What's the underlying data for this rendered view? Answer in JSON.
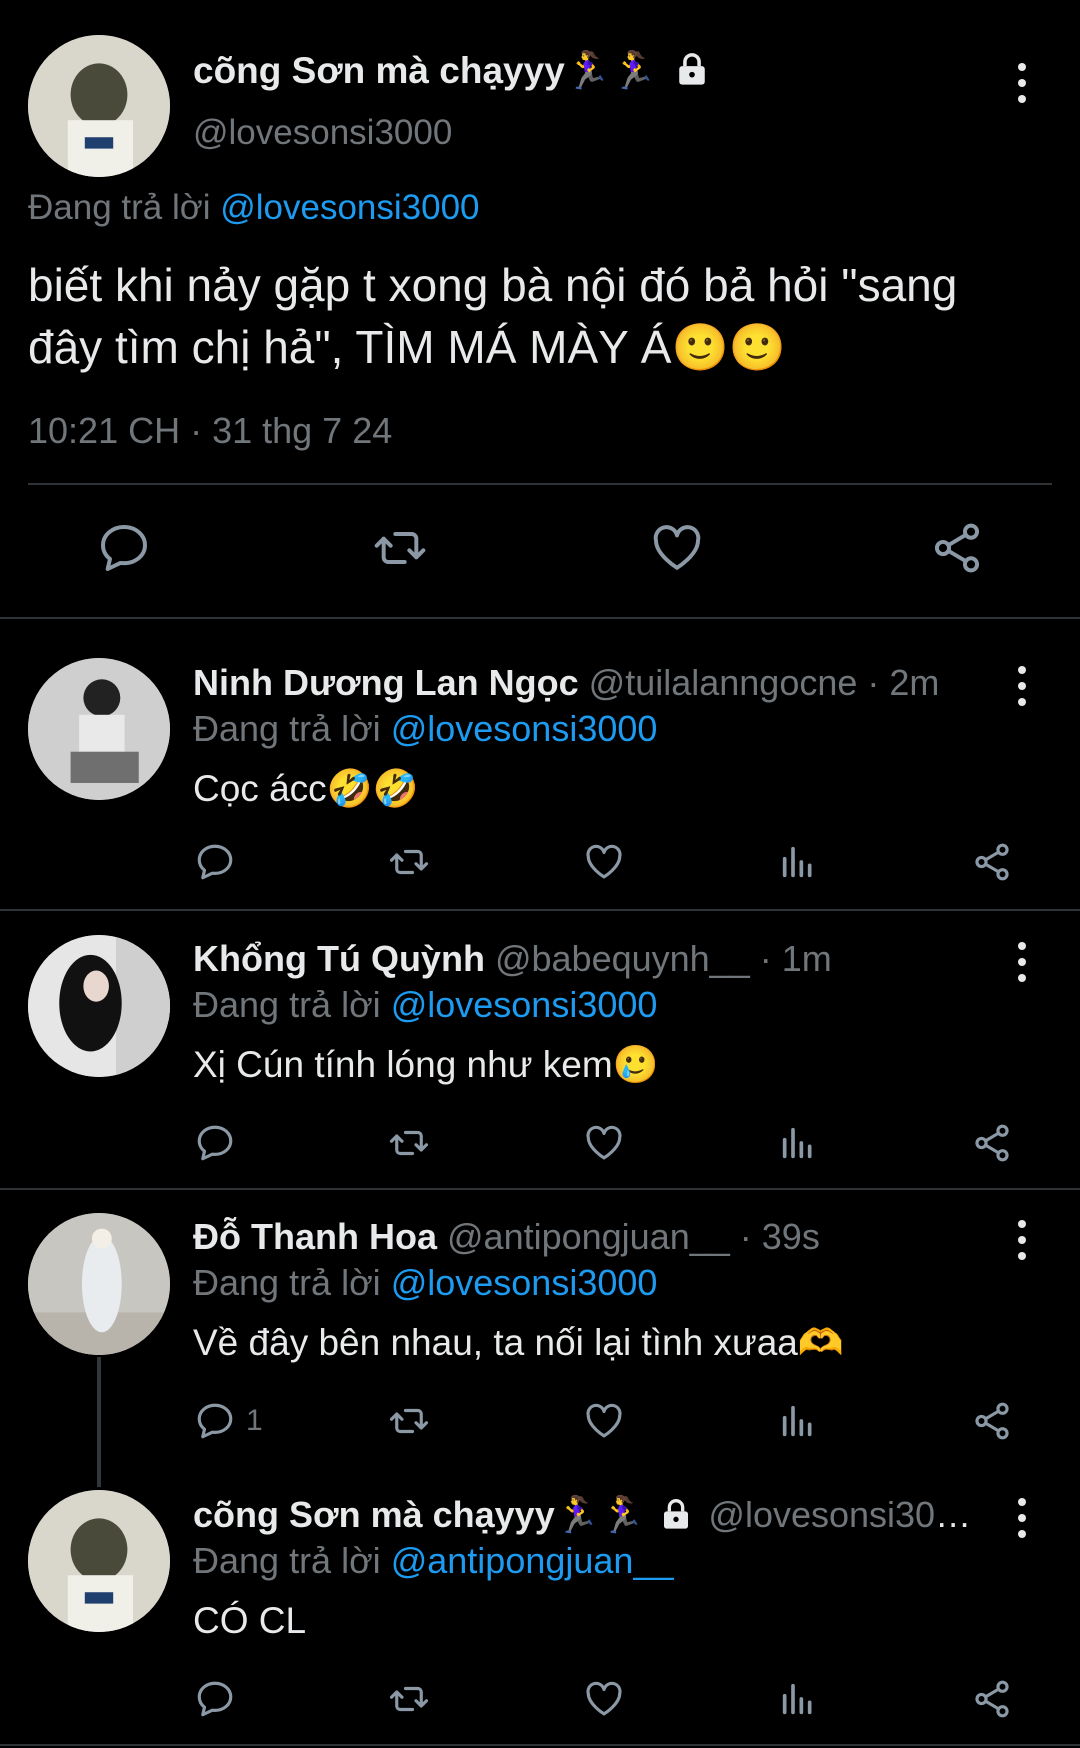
{
  "main": {
    "display_name": "cõng Sơn mà chạyyy🏃‍♀️🏃‍♀️",
    "handle": "@lovesonsi3000",
    "replying_prefix": "Đang trả lời",
    "replying_to": "@lovesonsi3000",
    "text": "biết khi nảy gặp t xong bà nội đó bả hỏi \"sang đây tìm chị hả\", TÌM MÁ MÀY Á🙂🙂",
    "timestamp": "10:21 CH · 31 thg 7 24"
  },
  "replies": [
    {
      "display_name": "Ninh Dương Lan Ngọc",
      "handle": "@tuilalanngocne",
      "time": "· 2m",
      "replying_prefix": "Đang trả lời",
      "replying_to": "@lovesonsi3000",
      "text": "Cọc ácc🤣🤣",
      "reply_count": ""
    },
    {
      "display_name": "Khổng Tú Quỳnh",
      "handle": "@babequynh__",
      "time": "· 1m",
      "replying_prefix": "Đang trả lời",
      "replying_to": "@lovesonsi3000",
      "text": "Xị Cún tính lóng như kem🥲",
      "reply_count": ""
    },
    {
      "display_name": "Đỗ Thanh Hoa",
      "handle": "@antipongjuan__",
      "time": "· 39s",
      "replying_prefix": "Đang trả lời",
      "replying_to": "@lovesonsi3000",
      "text": "Về đây bên nhau, ta nối lại tình xưaa🫶",
      "reply_count": "1"
    },
    {
      "display_name": "cõng Sơn mà chạyyy🏃‍♀️🏃‍♀️",
      "handle": "@lovesonsi300...",
      "time": "",
      "replying_prefix": "Đang trả lời",
      "replying_to": "@antipongjuan__",
      "text": "CÓ CL",
      "reply_count": ""
    }
  ],
  "icons": {
    "more": "more-vertical-icon",
    "reply": "reply-icon",
    "retweet": "retweet-icon",
    "like": "heart-icon",
    "views": "views-icon",
    "share": "share-icon",
    "lock": "lock-icon"
  },
  "colors": {
    "background": "#000000",
    "text": "#e7e9ea",
    "muted": "#71767b",
    "link": "#1d9bf0",
    "divider": "#2f3336"
  }
}
